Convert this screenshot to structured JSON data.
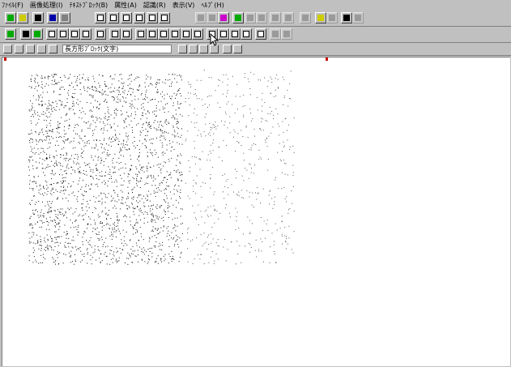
{
  "menu": [
    "ﾌｧｲﾙ(F)",
    "画像処理(I)",
    "ﾃｷｽﾄﾌﾞﾛｯｸ(B)",
    "属性(A)",
    "認識(R)",
    "表示(V)",
    "ﾍﾙﾌﾟ(H)"
  ],
  "toolbar3": {
    "mode_value": "長方形ﾌﾞﾛｯｸ(文字)"
  },
  "colors": {
    "chrome": "#c0c0c0",
    "canvas": "#ffffff",
    "marker": "#cc0000"
  }
}
